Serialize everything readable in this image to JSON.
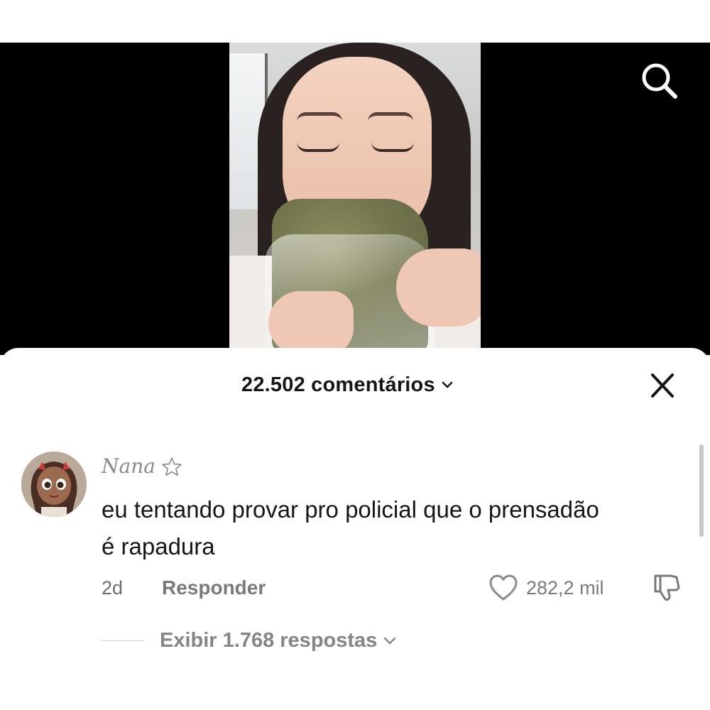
{
  "video": {
    "search_icon": "search-icon"
  },
  "comments_header": {
    "count_label": "22.502 comentários",
    "chevron_icon": "chevron-down-icon",
    "close_icon": "close-icon"
  },
  "comment": {
    "username": "Nana",
    "username_icon": "star-outline-icon",
    "text": "eu tentando provar pro policial que o prensadão é rapadura",
    "time": "2d",
    "reply_label": "Responder",
    "like_icon": "heart-outline-icon",
    "like_count": "282,2 mil",
    "dislike_icon": "thumbs-down-icon",
    "view_replies_label": "Exibir 1.768 respostas"
  },
  "colors": {
    "primary_text": "#161616",
    "secondary_text": "#7a7a7a",
    "video_background": "#000000"
  }
}
